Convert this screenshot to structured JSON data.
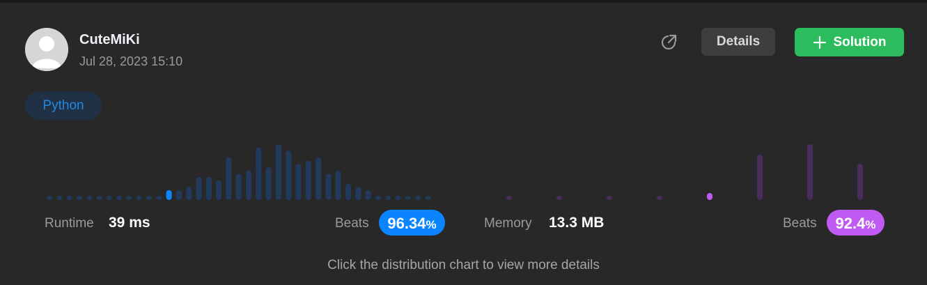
{
  "user": {
    "name": "CuteMiKi",
    "submitted": "Jul 28, 2023 15:10"
  },
  "header": {
    "details_label": "Details",
    "solution_label": "Solution",
    "share_icon": "share-icon",
    "plus_icon": "plus-icon"
  },
  "language": "Python",
  "runtime": {
    "label": "Runtime",
    "value": "39 ms",
    "beats_label": "Beats",
    "beats_number": "96.34",
    "beats_unit": "%",
    "color": "#0a84ff"
  },
  "memory": {
    "label": "Memory",
    "value": "13.3 MB",
    "beats_label": "Beats",
    "beats_number": "92.4",
    "beats_unit": "%",
    "color": "#bf5af2"
  },
  "hint": "Click the distribution chart to view more details",
  "colors": {
    "background": "#282828",
    "runtime_bar": "#213a5c",
    "runtime_bar_active": "#0a84ff",
    "memory_bar": "#4a2d5c",
    "memory_bar_active": "#bf5af2",
    "solution_button": "#2cbb5d",
    "details_button": "#3e3e3e"
  },
  "chart_data": [
    {
      "type": "bar",
      "name": "runtime-distribution",
      "values": [
        1,
        1,
        1,
        1,
        1,
        1,
        1,
        1,
        1,
        1,
        1,
        1,
        3,
        3,
        4,
        7,
        7,
        6,
        13,
        8,
        9,
        16,
        10,
        17,
        15,
        11,
        12,
        13,
        8,
        9,
        5,
        4,
        3,
        1,
        1,
        1,
        1,
        1,
        1
      ],
      "highlight_index": 12,
      "ylim": [
        0,
        17
      ]
    },
    {
      "type": "bar",
      "name": "memory-distribution",
      "values": [
        0.4,
        0.4,
        0.4,
        0.4,
        1,
        6.5,
        8,
        5.2
      ],
      "highlight_index": 4,
      "ylim": [
        0,
        8
      ]
    }
  ]
}
